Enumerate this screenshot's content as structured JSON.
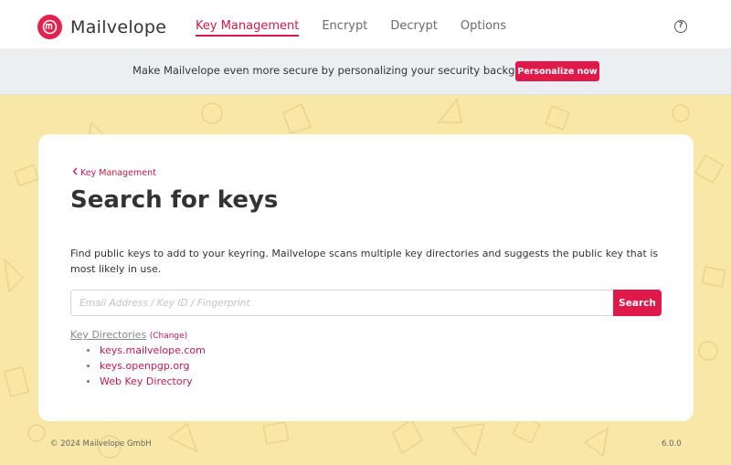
{
  "app": {
    "name": "Mailvelope",
    "logo_icon": "mailvelope-logo-icon"
  },
  "nav": {
    "items": [
      {
        "label": "Key Management",
        "active": true
      },
      {
        "label": "Encrypt",
        "active": false
      },
      {
        "label": "Decrypt",
        "active": false
      },
      {
        "label": "Options",
        "active": false
      }
    ],
    "help_icon": "help-circle-icon"
  },
  "banner": {
    "text": "Make Mailvelope even more secure by personalizing your security background.",
    "button_label": "Personalize now"
  },
  "page": {
    "breadcrumb": "Key Management",
    "title": "Search for keys",
    "intro": "Find public keys to add to your keyring. Mailvelope scans multiple key directories and suggests the public key that is most likely in use.",
    "search": {
      "placeholder": "Email Address / Key ID / Fingerprint",
      "value": "",
      "button_label": "Search"
    },
    "key_directories": {
      "label": "Key Directories",
      "change_label": "Change",
      "items": [
        "keys.mailvelope.com",
        "keys.openpgp.org",
        "Web Key Directory"
      ]
    }
  },
  "footer": {
    "copyright": "© 2024  Mailvelope GmbH",
    "version": "6.0.0"
  },
  "colors": {
    "accent": "#e0194b",
    "background": "#f8e7a6",
    "banner_bg": "#eceff1"
  }
}
